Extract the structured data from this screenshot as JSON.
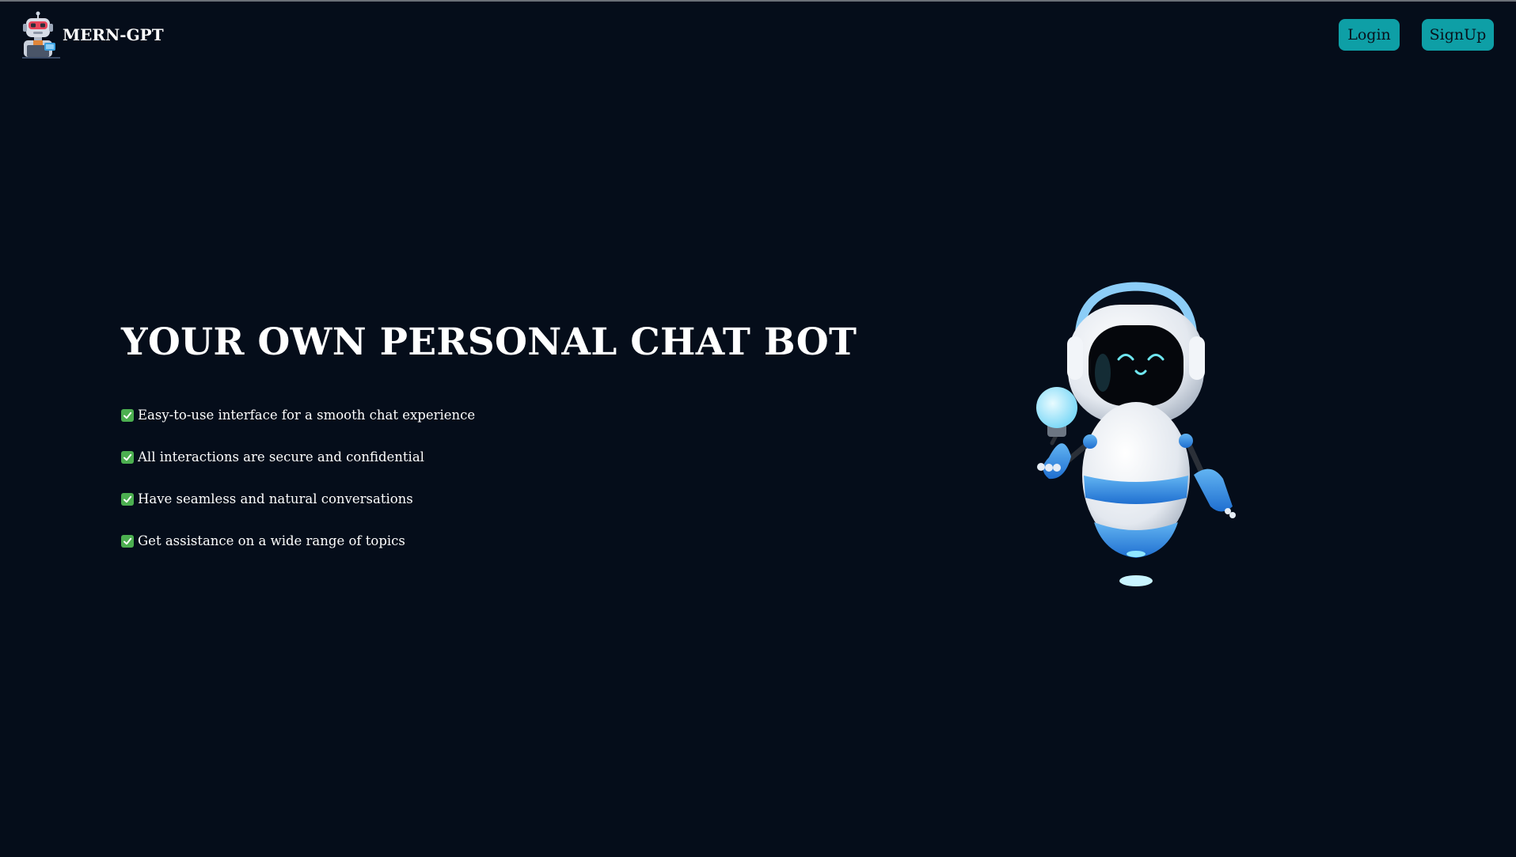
{
  "header": {
    "brand": "MERN-GPT",
    "login_label": "Login",
    "signup_label": "SignUp"
  },
  "hero": {
    "headline": "YOUR OWN PERSONAL CHAT BOT",
    "features": [
      "Easy-to-use interface for a smooth chat experience",
      "All interactions are secure and confidential",
      "Have seamless and natural conversations",
      "Get assistance on a wide range of topics"
    ]
  },
  "icons": {
    "logo": "robot-logo-icon",
    "feature_bullet": "green-check-icon",
    "illustration": "robot-illustration"
  },
  "colors": {
    "background": "#050d1a",
    "button": "#0e9fa6",
    "button_text": "#08121c",
    "check": "#4caf50"
  }
}
